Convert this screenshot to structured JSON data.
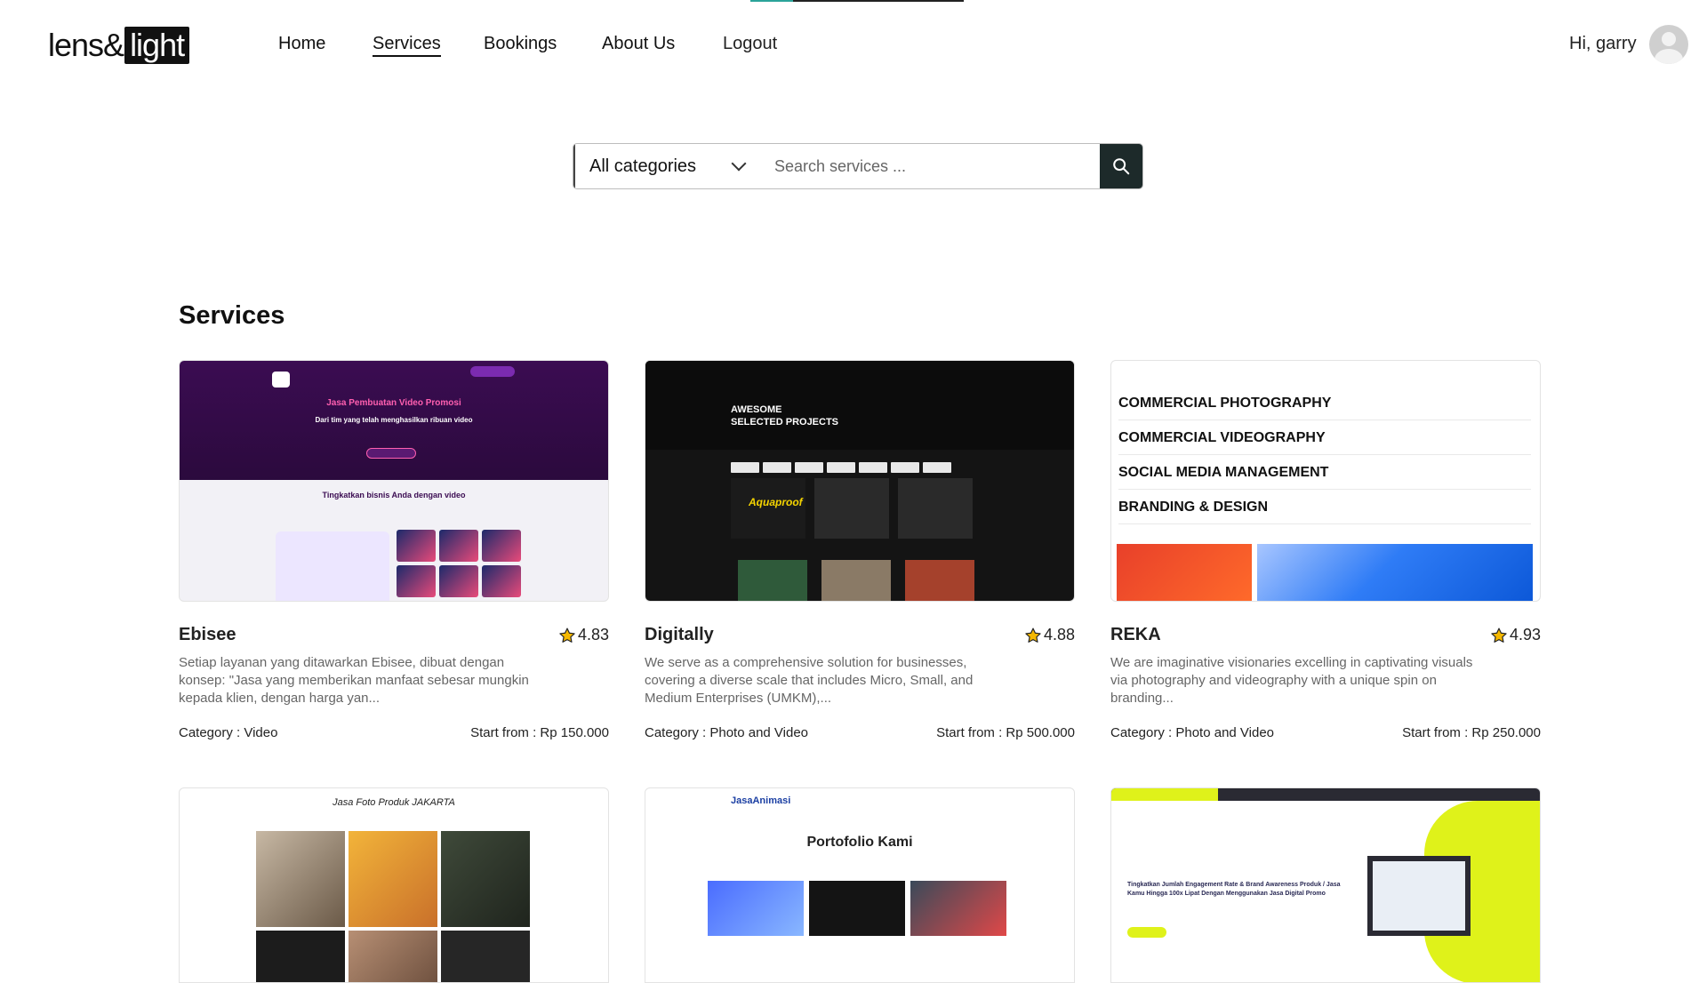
{
  "header": {
    "logo_left": "lens&",
    "logo_right": "light",
    "nav": [
      {
        "label": "Home",
        "active": false
      },
      {
        "label": "Services",
        "active": true
      },
      {
        "label": "Bookings",
        "active": false
      },
      {
        "label": "About Us",
        "active": false
      },
      {
        "label": "Logout",
        "active": false
      }
    ],
    "greeting": "Hi, garry"
  },
  "search": {
    "category": "All categories",
    "placeholder": "Search services ..."
  },
  "section_title": "Services",
  "cards": [
    {
      "title": "Ebisee",
      "rating": "4.83",
      "description": "Setiap layanan yang ditawarkan Ebisee, dibuat dengan konsep: \"Jasa yang memberikan manfaat sebesar mungkin kepada klien, dengan harga yan...",
      "category": "Category : Video",
      "price": "Start from : Rp 150.000",
      "thumb_text": [
        "Jasa Pembuatan Video Promosi",
        "Dari tim yang telah menghasilkan ribuan video",
        "Tingkatkan bisnis Anda dengan video"
      ]
    },
    {
      "title": "Digitally",
      "rating": "4.88",
      "description": "We serve as a comprehensive solution for businesses, covering a diverse scale that includes Micro, Small, and Medium Enterprises (UMKM),...",
      "category": "Category : Photo and Video",
      "price": "Start from : Rp 500.000",
      "thumb_text": [
        "AWESOME",
        "SELECTED PROJECTS",
        "Aquaproof"
      ]
    },
    {
      "title": "REKA",
      "rating": "4.93",
      "description": "We are imaginative visionaries excelling in captivating visuals via photography and videography with a unique spin on branding...",
      "category": "Category : Photo and Video",
      "price": "Start from : Rp 250.000",
      "thumb_text": [
        "COMMERCIAL PHOTOGRAPHY",
        "COMMERCIAL VIDEOGRAPHY",
        "SOCIAL MEDIA MANAGEMENT",
        "BRANDING & DESIGN"
      ]
    }
  ],
  "cards_row2": [
    {
      "thumb_text": [
        "Jasa Foto Produk JAKARTA"
      ]
    },
    {
      "thumb_text": [
        "JasaAnimasi",
        "Portofolio Kami"
      ]
    },
    {
      "thumb_text": [
        "Tingkatkan Jumlah Engagement Rate & Brand Awareness Produk / Jasa Kamu Hingga 100x Lipat Dengan Menggunakan Jasa Digital Promo"
      ]
    }
  ],
  "colors": {
    "accent_teal": "#2aa39a",
    "search_button": "#1d2a2a",
    "star": "#f5b800"
  }
}
